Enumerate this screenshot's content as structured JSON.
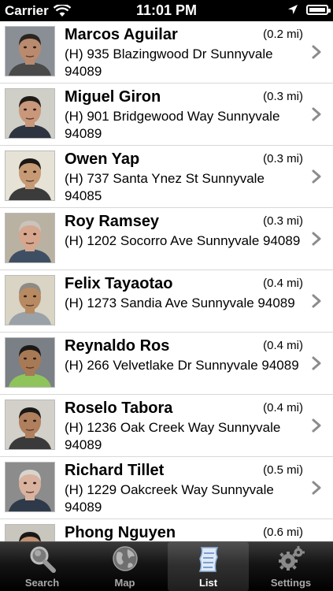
{
  "status_bar": {
    "carrier": "Carrier",
    "time": "11:01 PM"
  },
  "people": [
    {
      "name": "Marcos Aguilar",
      "distance": "(0.2 mi)",
      "address": "(H) 935 Blazingwood Dr Sunnyvale 94089"
    },
    {
      "name": "Miguel Giron",
      "distance": "(0.3 mi)",
      "address": "(H) 901 Bridgewood Way Sunnyvale 94089"
    },
    {
      "name": "Owen Yap",
      "distance": "(0.3 mi)",
      "address": "(H) 737 Santa Ynez St Sunnyvale 94085"
    },
    {
      "name": "Roy Ramsey",
      "distance": "(0.3 mi)",
      "address": "(H) 1202 Socorro Ave Sunnyvale 94089"
    },
    {
      "name": "Felix Tayaotao",
      "distance": "(0.4 mi)",
      "address": "(H) 1273 Sandia Ave Sunnyvale 94089"
    },
    {
      "name": "Reynaldo Ros",
      "distance": "(0.4 mi)",
      "address": "(H) 266 Velvetlake Dr Sunnyvale 94089"
    },
    {
      "name": "Roselo Tabora",
      "distance": "(0.4 mi)",
      "address": "(H) 1236 Oak Creek Way Sunnyvale 94089"
    },
    {
      "name": "Richard Tillet",
      "distance": "(0.5 mi)",
      "address": "(H) 1229 Oakcreek Way Sunnyvale 94089"
    },
    {
      "name": "Phong Nguyen",
      "distance": "(0.6 mi)",
      "address": ""
    }
  ],
  "tabs": [
    {
      "label": "Search",
      "icon": "magnifier-icon"
    },
    {
      "label": "Map",
      "icon": "globe-icon"
    },
    {
      "label": "List",
      "icon": "scroll-list-icon",
      "active": true
    },
    {
      "label": "Settings",
      "icon": "gears-icon"
    }
  ],
  "colors": {
    "status_bar_bg": "#000000",
    "tab_bar_bg": "#141414",
    "active_tab_text": "#ffffff",
    "inactive_tab_text": "#a8a8a8"
  }
}
